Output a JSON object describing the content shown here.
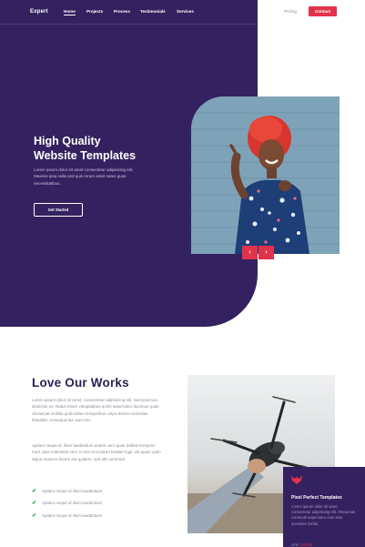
{
  "brand": "Expert",
  "nav": {
    "items": [
      "Home",
      "Projects",
      "Process",
      "Testimonials",
      "Services"
    ],
    "pricing": "Pricing",
    "contact": "Contact"
  },
  "hero": {
    "title_line1": "High Quality",
    "title_line2": "Website Templates",
    "description": "Lorem ipsum dolor sit amet consectetur adipisicing elit. Maxime ipsa nulla sed quis rerum amet natus quas necessitatibus.",
    "cta": "Get Started",
    "prev": "‹",
    "next": "›"
  },
  "works": {
    "title": "Love Our Works",
    "paragraph1": "Lorem ipsum dolor sit amet, consectetur adipisicing elit. Sed posimus distinctio ex. Natus totam voluptatibus animi aspernatur ducimus quas obcaecati mollitia quibusdam temporibus culpa dolore molestias blanditiis consequuntur sunt nisi.",
    "paragraph2": "Aptiam neque id, illum laudantium autem vero quae debitis tempora mod. Ipsa molestiae vero in rem et incidunt beatae fugit, ab quam optio atque maiores facere est quidem, sed alit commodi.",
    "bullets": [
      "Aptiam neque id illum laudantium",
      "Aptiam neque id illum laudantium",
      "Aptiam neque id illum laudantium"
    ]
  },
  "card": {
    "logo": "fox-logo-icon",
    "title": "Pixel Perfect Templates",
    "text": "Lorem ipsum dolor sit amet, consectetur adipisicing elit. Obcaecati commodi aspernatur eum eius inventore facilis.",
    "link_prefix": "Link",
    "link": "Colorlib"
  },
  "colors": {
    "primary": "#33225f",
    "accent": "#e0334b",
    "check": "#2e9e4b"
  }
}
